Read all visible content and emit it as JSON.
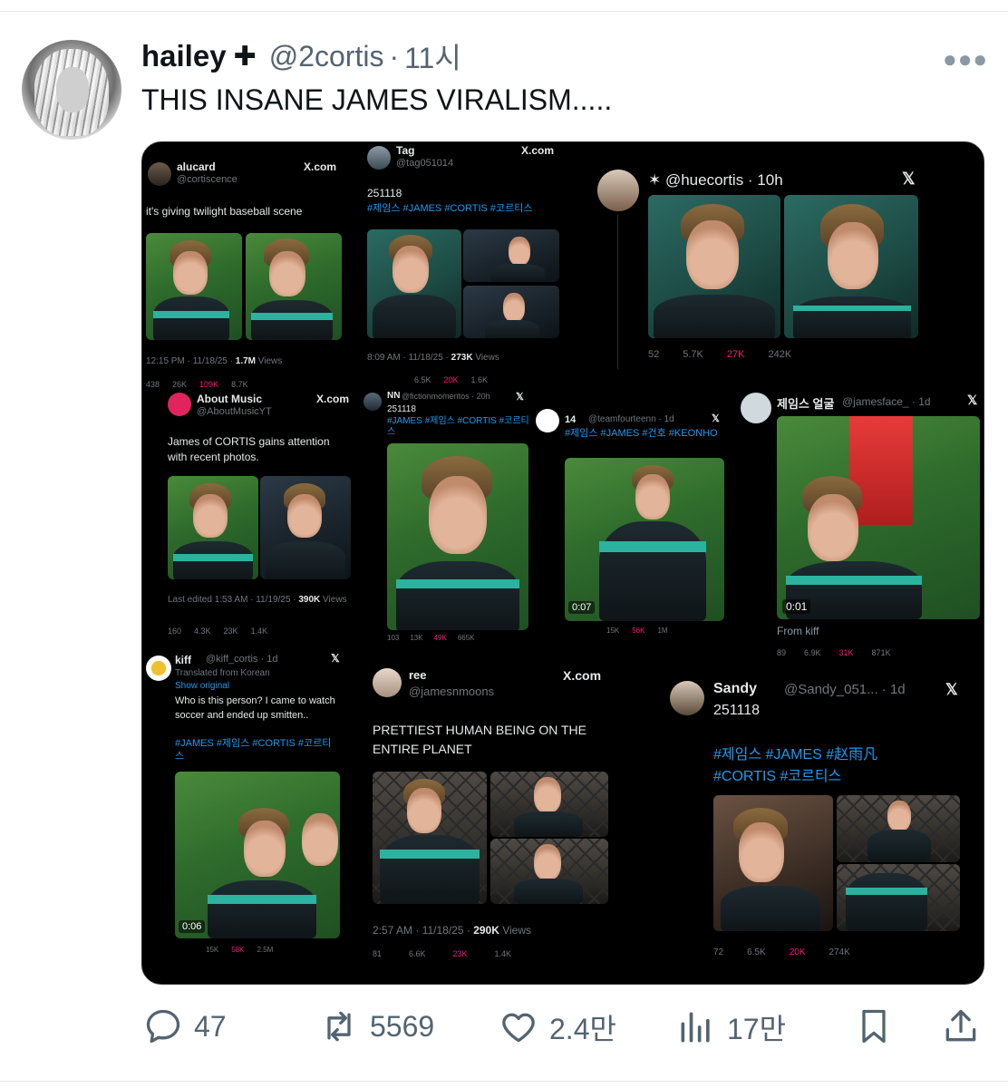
{
  "tweet": {
    "author_name": "hailey",
    "author_symbol": "✚",
    "handle": "@2cortis",
    "separator": "·",
    "time": "11시",
    "more_icon": "more-icon",
    "text": "THIS INSANE JAMES VIRALISM....."
  },
  "cards": {
    "c1": {
      "name": "alucard",
      "handle": "@cortiscence",
      "xlabel": "X.com",
      "text": "it's giving twilight baseball scene",
      "meta_pre": "12:15 PM · 11/18/25 · ",
      "meta_bold": "1.7M",
      "meta_post": " Views",
      "s1": "438",
      "s2": "26K",
      "s3": "109K",
      "s4": "8.7K"
    },
    "c2": {
      "name": "Tag",
      "handle": "@tag051014",
      "xlabel": "X.com",
      "text": "251118",
      "tags": "#제임스 #JAMES #CORTIS #코르티스",
      "meta_pre": "8:09 AM · 11/18/25 · ",
      "meta_bold": "273K",
      "meta_post": " Views",
      "s2": "6.5K",
      "s3": "20K",
      "s4": "1.6K"
    },
    "c3": {
      "handle": "✶ @huecortis · 10h",
      "xlabel": "𝕏",
      "s1": "52",
      "s2": "5.7K",
      "s3": "27K",
      "s4": "242K"
    },
    "c4": {
      "name": "About Music",
      "handle": "@AboutMusicYT",
      "xlabel": "X.com",
      "text": "James of CORTIS gains attention with recent photos.",
      "meta_pre": "Last edited 1:53 AM · 11/19/25 · ",
      "meta_bold": "390K",
      "meta_post": "Views",
      "s1": "160",
      "s2": "4.3K",
      "s3": "23K",
      "s4": "1.4K"
    },
    "c5": {
      "name": "NN",
      "handle": "@fictionmomentos · 20h",
      "xlabel": "𝕏",
      "text": "251118",
      "tags": "#JAMES #제임스 #CORTIS #코르티스",
      "s1": "103",
      "s2": "13K",
      "s3": "49K",
      "s4": "665K"
    },
    "c6": {
      "name": "14",
      "handle": "@teamfourteenn · 1d",
      "xlabel": "𝕏",
      "tags": "#제임스 #JAMES #건호 #KEONHO",
      "duration": "0:07",
      "s2": "15K",
      "s3": "56K",
      "s4": "1M"
    },
    "c7": {
      "name": "제임스 얼굴",
      "handle": "@jamesface_ · 1d",
      "xlabel": "𝕏",
      "duration": "0:01",
      "caption": "From kiff",
      "s1": "89",
      "s2": "6.9K",
      "s3": "31K",
      "s4": "871K"
    },
    "c8": {
      "name": "kiff",
      "handle": "@kiff_cortis · 1d",
      "xlabel": "𝕏",
      "translated": "Translated from Korean",
      "show_original": "Show original",
      "text": "Who is this person? I came to watch soccer and ended up smitten..",
      "tags": "#JAMES #제임스 #CORTIS #코르티스",
      "duration": "0:06",
      "s2": "15K",
      "s3": "58K",
      "s4": "2.5M"
    },
    "c9": {
      "name": "ree",
      "handle": "@jamesnmoons",
      "xlabel": "X.com",
      "text": "PRETTIEST HUMAN BEING ON THE ENTIRE PLANET",
      "meta_pre": "2:57 AM · 11/18/25 · ",
      "meta_bold": "290K",
      "meta_post": " Views",
      "s1": "81",
      "s2": "6.6K",
      "s3": "23K",
      "s4": "1.4K"
    },
    "c10": {
      "name": "Sandy",
      "handle": "@Sandy_051... · 1d",
      "xlabel": "𝕏",
      "text": "251118",
      "tags": "#제임스 #JAMES #赵雨凡 #CORTIS #코르티스",
      "s1": "72",
      "s2": "6.5K",
      "s3": "20K",
      "s4": "274K"
    }
  },
  "stats": {
    "replies": "47",
    "reposts": "5569",
    "likes": "2.4만",
    "views": "17만"
  },
  "colors": {
    "like_pink": "#f91880",
    "link_blue": "#1d9bf0",
    "muted": "#536471"
  }
}
